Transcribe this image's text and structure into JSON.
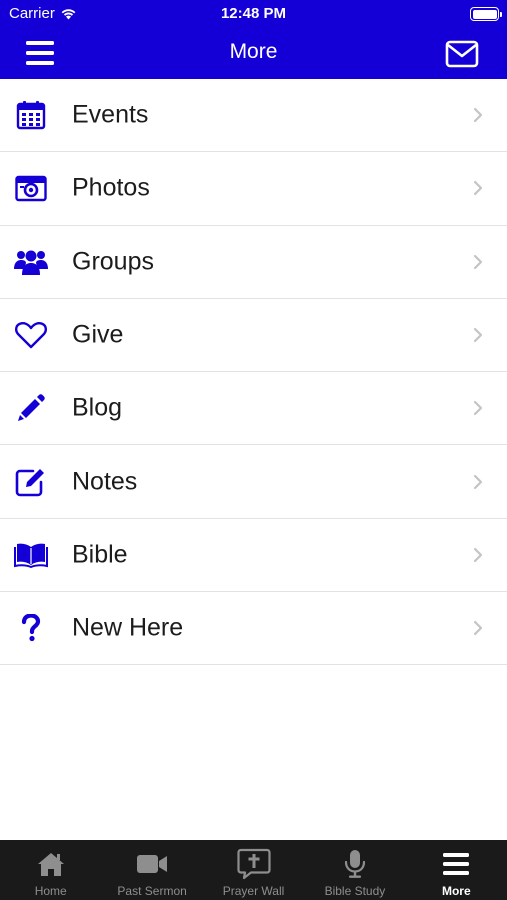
{
  "status_bar": {
    "carrier": "Carrier",
    "time": "12:48 PM"
  },
  "nav": {
    "title": "More",
    "left_icon": "hamburger-menu-icon",
    "right_icon": "envelope-icon"
  },
  "colors": {
    "brand": "#1400d6",
    "icon": "#1400d6",
    "tab_bar": "#1a1a1a",
    "tab_inactive": "#8e8e8e",
    "tab_active": "#ffffff"
  },
  "menu_items": [
    {
      "label": "Events",
      "icon": "calendar-icon"
    },
    {
      "label": "Photos",
      "icon": "camera-icon"
    },
    {
      "label": "Groups",
      "icon": "people-icon"
    },
    {
      "label": "Give",
      "icon": "heart-icon"
    },
    {
      "label": "Blog",
      "icon": "pencil-icon"
    },
    {
      "label": "Notes",
      "icon": "edit-note-icon"
    },
    {
      "label": "Bible",
      "icon": "open-book-icon"
    },
    {
      "label": "New Here",
      "icon": "question-mark-icon"
    }
  ],
  "tabs": [
    {
      "label": "Home",
      "icon": "home-icon",
      "active": false
    },
    {
      "label": "Past Sermon",
      "icon": "video-camera-icon",
      "active": false
    },
    {
      "label": "Prayer Wall",
      "icon": "prayer-bubble-icon",
      "active": false
    },
    {
      "label": "Bible Study",
      "icon": "microphone-icon",
      "active": false
    },
    {
      "label": "More",
      "icon": "hamburger-menu-icon",
      "active": true
    }
  ]
}
